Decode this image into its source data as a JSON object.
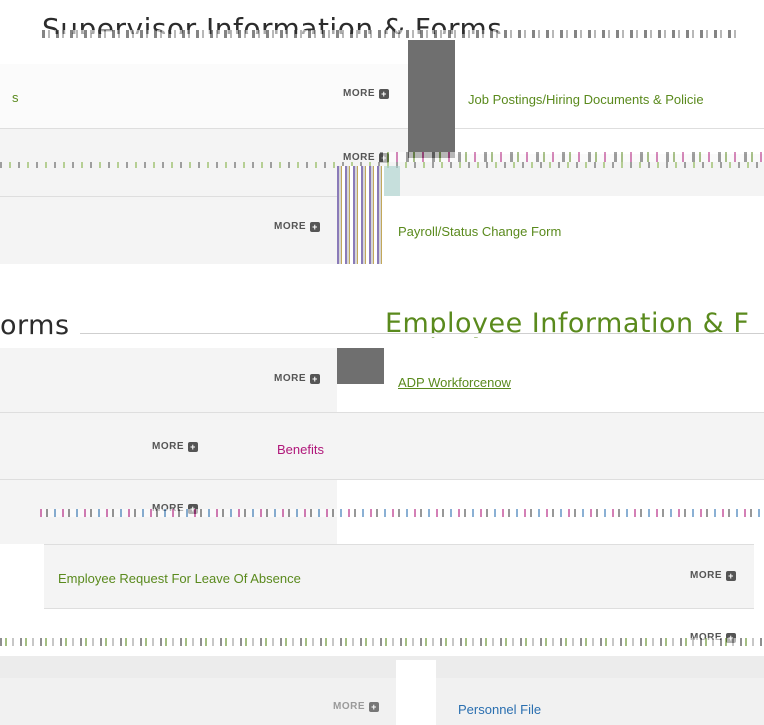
{
  "supervisor": {
    "heading": "Supervisor Information & Forms",
    "rows": [
      {
        "left_label": "s",
        "more": "MORE",
        "right_label": "Job Postings/Hiring Documents & Policie"
      },
      {
        "more": "MORE"
      },
      {
        "more": "MORE",
        "right_label": "Payroll/Status Change Form"
      }
    ]
  },
  "forms": {
    "heading": "orms",
    "rows": [
      {
        "more": "MORE"
      },
      {
        "more": "MORE"
      },
      {
        "more": "MORE"
      }
    ]
  },
  "employee": {
    "heading": "Employee Information & F",
    "rows": [
      {
        "label": "ADP Workforcenow"
      },
      {
        "label": "Benefits"
      },
      {
        "label": "Employee Request For Leave Of Absence",
        "more": "MORE"
      },
      {
        "more": "MORE"
      },
      {
        "more": "MORE",
        "label": "Personnel File"
      }
    ]
  },
  "colors": {
    "green": "#5a8a1d",
    "magenta": "#b0177a",
    "blue": "#2a6fb0"
  }
}
